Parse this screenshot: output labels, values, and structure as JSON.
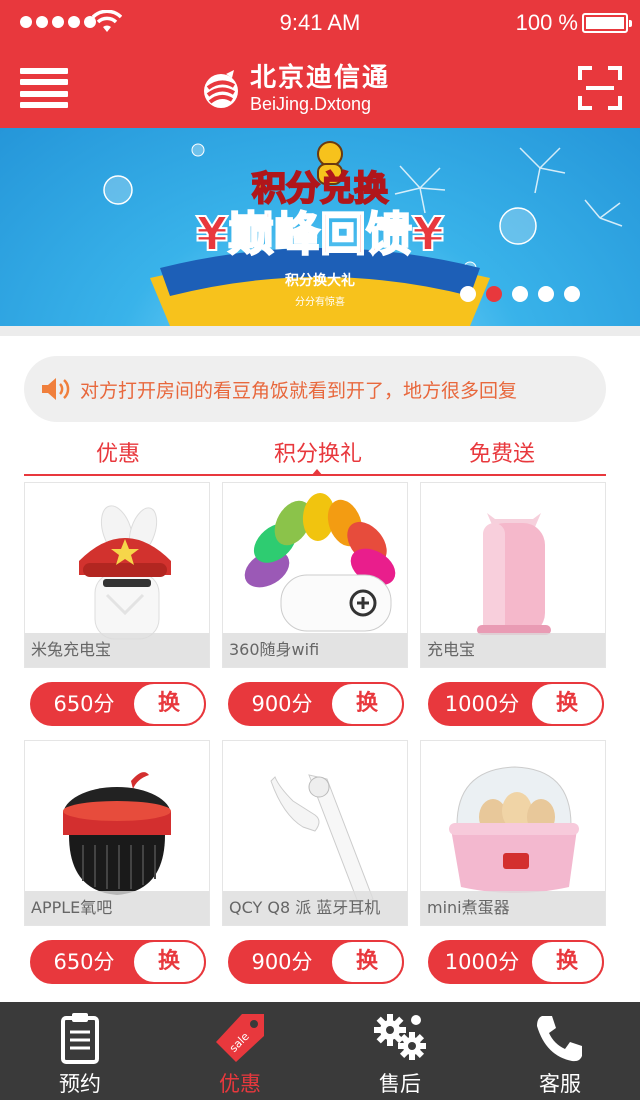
{
  "status_bar": {
    "time": "9:41 AM",
    "battery": "100 %"
  },
  "header": {
    "brand_cn": "北京迪信通",
    "brand_en": "BeiJing.Dxtong"
  },
  "banner": {
    "line1": "积分兑换",
    "line2": "¥巅峰回馈¥",
    "ribbon": "积分换大礼",
    "sub": "分分有惊喜",
    "slides": 5,
    "active_slide": 2
  },
  "notice": {
    "text": "对方打开房间的看豆角饭就看到开了，地方很多回复"
  },
  "tabs": [
    {
      "label": "优惠"
    },
    {
      "label": "积分换礼"
    },
    {
      "label": "免费送"
    }
  ],
  "active_tab": 1,
  "products": [
    {
      "name": "米兔充电宝",
      "points": "650分",
      "action": "换"
    },
    {
      "name": "360随身wifi",
      "points": "900分",
      "action": "换"
    },
    {
      "name": "充电宝",
      "points": "1000分",
      "action": "换"
    },
    {
      "name": "APPLE氧吧",
      "points": "650分",
      "action": "换"
    },
    {
      "name": "QCY Q8 派 蓝牙耳机",
      "points": "900分",
      "action": "换"
    },
    {
      "name": "mini煮蛋器",
      "points": "1000分",
      "action": "换"
    }
  ],
  "tabbar": [
    {
      "label": "预约",
      "icon": "clipboard-icon"
    },
    {
      "label": "优惠",
      "icon": "sale-tag-icon"
    },
    {
      "label": "售后",
      "icon": "gears-icon"
    },
    {
      "label": "客服",
      "icon": "phone-icon"
    }
  ],
  "active_tabbar": 1,
  "colors": {
    "accent": "#e8383d",
    "tabbar_bg": "#3a3a3a",
    "notice_text": "#e8683d"
  }
}
